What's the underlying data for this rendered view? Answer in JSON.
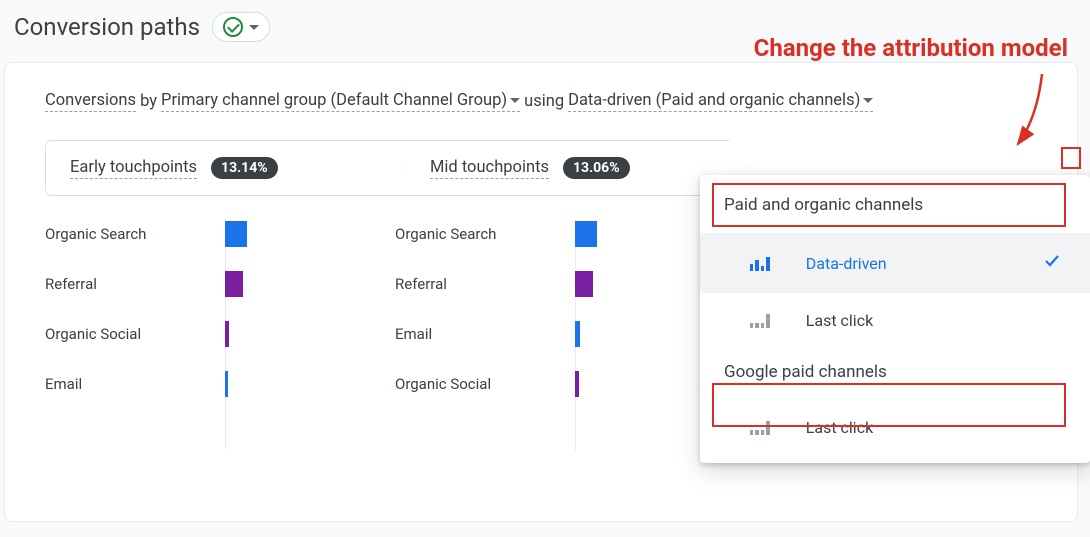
{
  "page_title": "Conversion paths",
  "annotation": "Change the attribution model",
  "sentence": {
    "conversions": "Conversions",
    "by": " by ",
    "dimension": "Primary channel group (Default Channel Group)",
    "using": " using ",
    "model": "Data-driven (Paid and organic channels)"
  },
  "touchpoints": [
    {
      "label": "Early touchpoints",
      "value": "13.14%"
    },
    {
      "label": "Mid touchpoints",
      "value": "13.06%"
    }
  ],
  "dropdown": {
    "section1": "Paid and organic channels",
    "opt1": "Data-driven",
    "opt2": "Last click",
    "section2": "Google paid channels",
    "opt3": "Last click"
  },
  "chart_data": [
    {
      "type": "bar",
      "title": "Early touchpoints",
      "orientation": "horizontal",
      "categories": [
        "Organic Search",
        "Referral",
        "Organic Social",
        "Email"
      ],
      "values": [
        22,
        18,
        4,
        3
      ],
      "colors": [
        "#1a73e8",
        "#7b1fa2",
        "#7b1fa2",
        "#1a73e8"
      ]
    },
    {
      "type": "bar",
      "title": "Mid touchpoints",
      "orientation": "horizontal",
      "categories": [
        "Organic Search",
        "Referral",
        "Email",
        "Organic Social"
      ],
      "values": [
        22,
        18,
        5,
        4
      ],
      "colors": [
        "#1a73e8",
        "#7b1fa2",
        "#1a73e8",
        "#7b1fa2"
      ]
    }
  ]
}
